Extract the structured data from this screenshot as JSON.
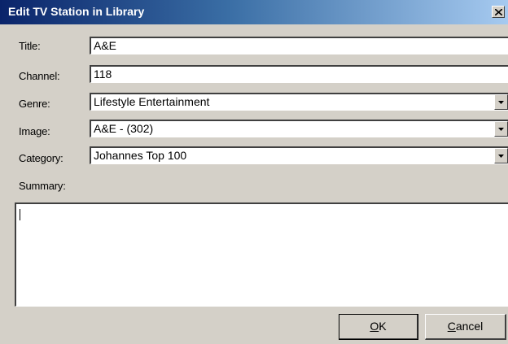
{
  "window": {
    "title": "Edit TV Station in Library"
  },
  "form": {
    "title": {
      "label": "Title:",
      "value": "A&E"
    },
    "channel": {
      "label": "Channel:",
      "value": "118"
    },
    "genre": {
      "label": "Genre:",
      "value": "Lifestyle Entertainment"
    },
    "image": {
      "label": "Image:",
      "value": "A&E - (302)"
    },
    "category": {
      "label": "Category:",
      "value": "Johannes Top 100"
    },
    "summary": {
      "label": "Summary:",
      "value": ""
    }
  },
  "buttons": {
    "ok": {
      "mnemonic": "O",
      "rest": "K"
    },
    "cancel": {
      "mnemonic": "C",
      "rest": "ancel"
    }
  }
}
